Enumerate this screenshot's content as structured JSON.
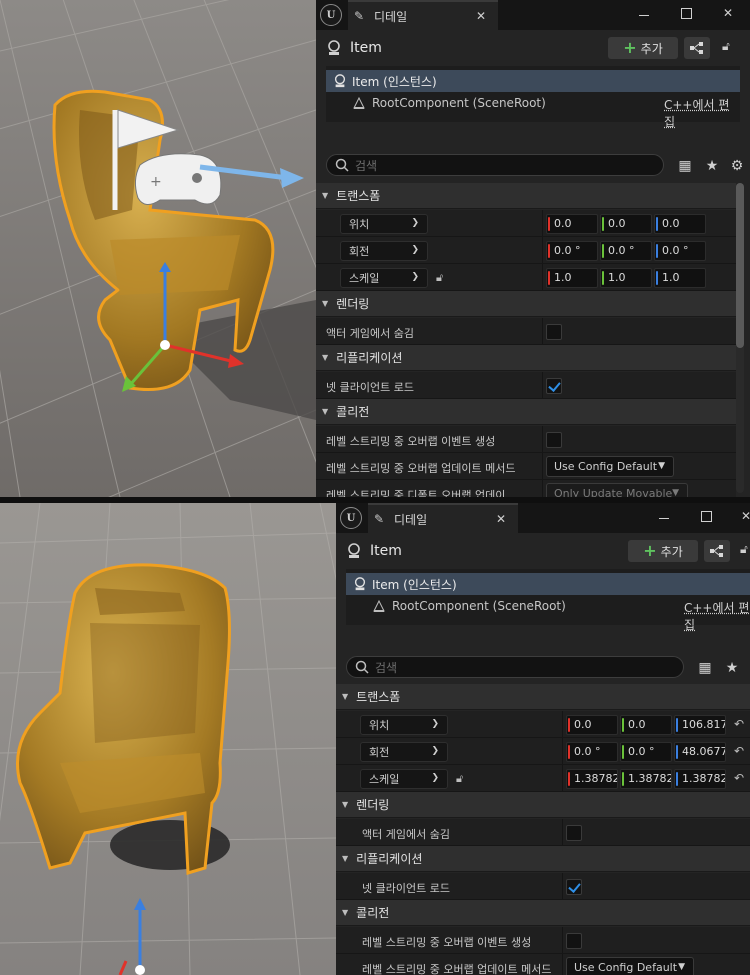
{
  "panels": [
    {
      "tab_label": "디테일",
      "actor_name": "Item",
      "add_label": "추가",
      "tree_instance": "Item (인스턴스)",
      "tree_component": "RootComponent (SceneRoot)",
      "cpp_edit": "C++에서 편집",
      "search_placeholder": "검색",
      "categories": {
        "transform": "트랜스폼",
        "rendering": "렌더링",
        "replication": "리플리케이션",
        "collision": "콜리전"
      },
      "transform": {
        "location_label": "위치",
        "location": [
          "0.0",
          "0.0",
          "0.0"
        ],
        "rotation_label": "회전",
        "rotation": [
          "0.0 °",
          "0.0 °",
          "0.0 °"
        ],
        "scale_label": "스케일",
        "scale": [
          "1.0",
          "1.0",
          "1.0"
        ]
      },
      "rendering": {
        "hidden_in_game_label": "액터 게임에서 숨김",
        "hidden_in_game": false
      },
      "replication": {
        "net_load_label": "넷 클라이언트 로드",
        "net_load": true
      },
      "collision": {
        "overlap_events_label": "레벨 스트리밍 중 오버랩 이벤트 생성",
        "overlap_events": false,
        "update_method_label": "레벨 스트리밍 중 오버랩 업데이트 메서드",
        "update_method_value": "Use Config Default",
        "default_update_label": "레벨 스트리밍 중 디폴트 오버랩 업데이...",
        "default_update_value": "Only Update Movable"
      }
    },
    {
      "tab_label": "디테일",
      "actor_name": "Item",
      "add_label": "추가",
      "tree_instance": "Item (인스턴스)",
      "tree_component": "RootComponent (SceneRoot)",
      "cpp_edit": "C++에서 편집",
      "search_placeholder": "검색",
      "categories": {
        "transform": "트랜스폼",
        "rendering": "렌더링",
        "replication": "리플리케이션",
        "collision": "콜리전"
      },
      "transform": {
        "location_label": "위치",
        "location": [
          "0.0",
          "0.0",
          "106.817"
        ],
        "rotation_label": "회전",
        "rotation": [
          "0.0 °",
          "0.0 °",
          "48.0677"
        ],
        "scale_label": "스케일",
        "scale": [
          "1.38782",
          "1.38782",
          "1.38782"
        ]
      },
      "rendering": {
        "hidden_in_game_label": "액터 게임에서 숨김",
        "hidden_in_game": false
      },
      "replication": {
        "net_load_label": "넷 클라이언트 로드",
        "net_load": true
      },
      "collision": {
        "overlap_events_label": "레벨 스트리밍 중 오버랩 이벤트 생성",
        "overlap_events": false,
        "update_method_label": "레벨 스트리밍 중 오버랩 업데이트 메서드",
        "update_method_value": "Use Config Default"
      }
    }
  ],
  "colors": {
    "axis_x": "#e0322a",
    "axis_y": "#6ac23a",
    "axis_z": "#3a7fe0",
    "selection": "#f0a020",
    "check": "#2f8fe6"
  }
}
